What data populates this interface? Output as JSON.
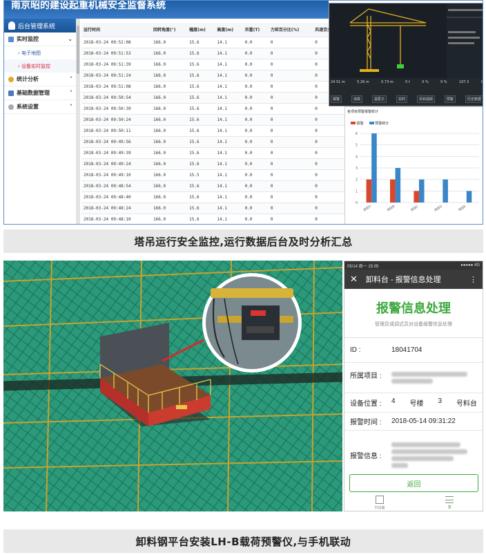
{
  "top": {
    "app_title": "南京昭的建设起重机械安全监督系统",
    "sidebar": {
      "header": "后台管理系统",
      "items": [
        {
          "label": "实时监控",
          "subs": [
            "电子地图",
            "设备实时监控"
          ]
        },
        {
          "label": "统计分析"
        },
        {
          "label": "基础数据管理"
        },
        {
          "label": "系统设置"
        }
      ]
    },
    "table": {
      "headers": [
        "运行时间",
        "回转角度(°)",
        "幅度(m)",
        "高度(m)",
        "吊重(T)",
        "力矩百分比(%)",
        "风速百分比"
      ],
      "rows": [
        [
          "2018-03-24 09:52:08",
          "166.0",
          "15.6",
          "14.1",
          "0.0",
          "0",
          "0"
        ],
        [
          "2018-03-24 09:51:53",
          "166.0",
          "15.6",
          "14.1",
          "0.0",
          "0",
          "0"
        ],
        [
          "2018-03-24 09:51:39",
          "166.0",
          "15.6",
          "14.1",
          "0.0",
          "0",
          "0"
        ],
        [
          "2018-03-24 09:51:24",
          "166.0",
          "15.6",
          "14.1",
          "0.0",
          "0",
          "0"
        ],
        [
          "2018-03-24 09:51:08",
          "166.0",
          "15.6",
          "14.1",
          "0.0",
          "0",
          "0"
        ],
        [
          "2018-03-24 09:50:54",
          "166.0",
          "15.6",
          "14.1",
          "0.0",
          "0",
          "0"
        ],
        [
          "2018-03-24 09:50:39",
          "166.0",
          "15.6",
          "14.1",
          "0.0",
          "0",
          "0"
        ],
        [
          "2018-03-24 09:50:24",
          "166.0",
          "15.6",
          "14.1",
          "0.0",
          "0",
          "0"
        ],
        [
          "2018-03-24 09:50:11",
          "166.0",
          "15.6",
          "14.1",
          "0.0",
          "0",
          "0"
        ],
        [
          "2018-03-24 09:49:56",
          "166.0",
          "15.6",
          "14.1",
          "0.0",
          "0",
          "0"
        ],
        [
          "2018-03-24 09:49:39",
          "166.0",
          "15.6",
          "14.1",
          "0.0",
          "0",
          "0"
        ],
        [
          "2018-03-24 09:49:24",
          "166.0",
          "15.6",
          "14.1",
          "0.0",
          "0",
          "0"
        ],
        [
          "2018-03-24 09:49:10",
          "166.0",
          "15.5",
          "14.1",
          "0.0",
          "0",
          "0"
        ],
        [
          "2018-03-24 09:48:54",
          "166.0",
          "15.6",
          "14.1",
          "0.0",
          "0",
          "0"
        ],
        [
          "2018-03-24 09:48:40",
          "166.0",
          "15.6",
          "14.1",
          "0.0",
          "0",
          "0"
        ],
        [
          "2018-03-24 09:48:24",
          "166.0",
          "15.6",
          "14.1",
          "0.0",
          "0",
          "0"
        ],
        [
          "2018-03-24 09:48:10",
          "166.0",
          "15.6",
          "14.1",
          "0.0",
          "0",
          "0"
        ]
      ]
    },
    "crane_panel": {
      "readouts": [
        "24.51 m",
        "5.26 m",
        "0.73 m",
        "0 t",
        "0 %",
        "0 %",
        "107.3",
        "0"
      ],
      "buttons": [
        "报警",
        "违章",
        "黑匣子",
        "实时",
        "吊钩视频",
        "预警",
        "历史数据"
      ]
    },
    "analysis_chart": {
      "title": "各项目预警报警统计",
      "legend": [
        "报警",
        "预警统计"
      ],
      "colors": {
        "alarm": "#d9472b",
        "warn": "#3a86c8"
      }
    }
  },
  "chart_data": {
    "type": "bar",
    "title": "各项目预警报警统计",
    "categories": [
      "项目A",
      "项目B",
      "项目C",
      "项目D",
      "项目E"
    ],
    "series": [
      {
        "name": "报警",
        "values": [
          2,
          2,
          1,
          0,
          0
        ]
      },
      {
        "name": "预警统计",
        "values": [
          6,
          3,
          2,
          2,
          1
        ]
      }
    ],
    "ylim": [
      0,
      6
    ],
    "yticks": [
      0,
      1,
      2,
      3,
      4,
      5,
      6
    ]
  },
  "caption1": "塔吊运行安全监控,运行数据后台及时分析汇总",
  "caption2": "卸料钢平台安装LH-B载荷预警仪,与手机联动",
  "phone": {
    "status_left": "05/14 周一 15:05",
    "status_right": "●●●●● 4G",
    "header_title": "卸料台 - 报警信息处理",
    "page_title": "报警信息处理",
    "page_subtitle": "管理员或调式员对设备报警信息处理",
    "id_label": "ID :",
    "id_value": "18041704",
    "project_label": "所属项目 :",
    "location_label": "设备位置 :",
    "location_value1": "4",
    "location_unit1": "号楼",
    "location_value2": "3",
    "location_unit2": "号料台",
    "time_label": "报警时间 :",
    "time_value": "2018-05-14 09:31:22",
    "info_label": "报警信息 :",
    "back_button": "返回",
    "tab_left": "扫设备",
    "tab_right": "首"
  }
}
